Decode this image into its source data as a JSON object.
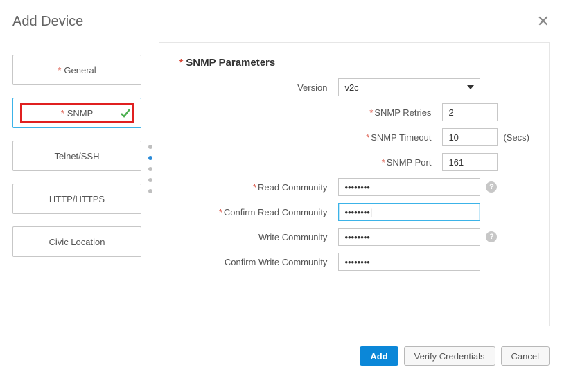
{
  "header": {
    "title": "Add Device"
  },
  "sidebar": {
    "items": [
      {
        "label": "General",
        "required": true
      },
      {
        "label": "SNMP",
        "required": true,
        "active": true,
        "checked": true
      },
      {
        "label": "Telnet/SSH"
      },
      {
        "label": "HTTP/HTTPS"
      },
      {
        "label": "Civic Location"
      }
    ]
  },
  "panel": {
    "title": "SNMP Parameters",
    "fields": {
      "version_label": "Version",
      "version_value": "v2c",
      "retries_label": "SNMP Retries",
      "retries_value": "2",
      "timeout_label": "SNMP Timeout",
      "timeout_value": "10",
      "timeout_suffix": "(Secs)",
      "port_label": "SNMP Port",
      "port_value": "161",
      "read_label": "Read Community",
      "read_value": "••••••••",
      "confirm_read_label": "Confirm Read Community",
      "confirm_read_value": "••••••••|",
      "write_label": "Write Community",
      "write_value": "••••••••",
      "confirm_write_label": "Confirm Write Community",
      "confirm_write_value": "••••••••"
    }
  },
  "footer": {
    "add": "Add",
    "verify": "Verify Credentials",
    "cancel": "Cancel"
  },
  "help_glyph": "?"
}
